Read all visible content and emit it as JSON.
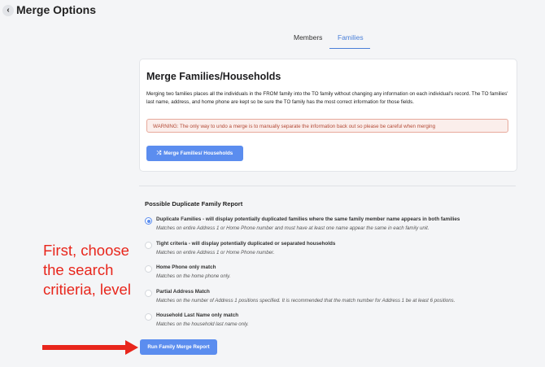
{
  "header": {
    "back_icon": "chevron-left-icon",
    "back_glyph": "‹",
    "title": "Merge Options"
  },
  "tabs": [
    {
      "label": "Members",
      "active": false
    },
    {
      "label": "Families",
      "active": true
    }
  ],
  "card": {
    "title": "Merge Families/Households",
    "description": "Merging two families places all the individuals in the FROM family into the TO family without changing any information on each individual's record. The TO families' last name, address, and home phone are kept so be sure the TO family has the most correct information for those fields.",
    "warning": "WARNING: The only way to undo a merge is to manually separate the information back out so please be careful when merging",
    "merge_button": {
      "icon": "shuffle-icon",
      "glyph": "⤮",
      "label": "Merge Families/ Households"
    }
  },
  "report": {
    "title": "Possible Duplicate Family Report",
    "options": [
      {
        "label": "Duplicate Families - will display potentially duplicated families where the same family member name appears in both families",
        "description": "Matches on entire Address 1 or Home Phone number and must have at least one name appear the same in each family unit.",
        "checked": true
      },
      {
        "label": "Tight criteria - will display potentially duplicated or separated households",
        "description": "Matches on entire Address 1 or Home Phone number.",
        "checked": false
      },
      {
        "label": "Home Phone only match",
        "description": "Matches on the home phone only.",
        "checked": false
      },
      {
        "label": "Partial Address Match",
        "description": "Matches on the number of Address 1 positions specified. It is recommended that the match number for Address 1 be at least 6 positions.",
        "checked": false
      },
      {
        "label": "Household Last Name only match",
        "description": "Matches on the household last name only.",
        "checked": false
      }
    ],
    "run_button": "Run Family Merge Report"
  },
  "annotation": {
    "text": "First, choose the search critieria, level",
    "color": "#e8261c"
  },
  "colors": {
    "accent": "#5b8def",
    "warning_bg": "#fbeeeb",
    "warning_text": "#b34a36"
  }
}
